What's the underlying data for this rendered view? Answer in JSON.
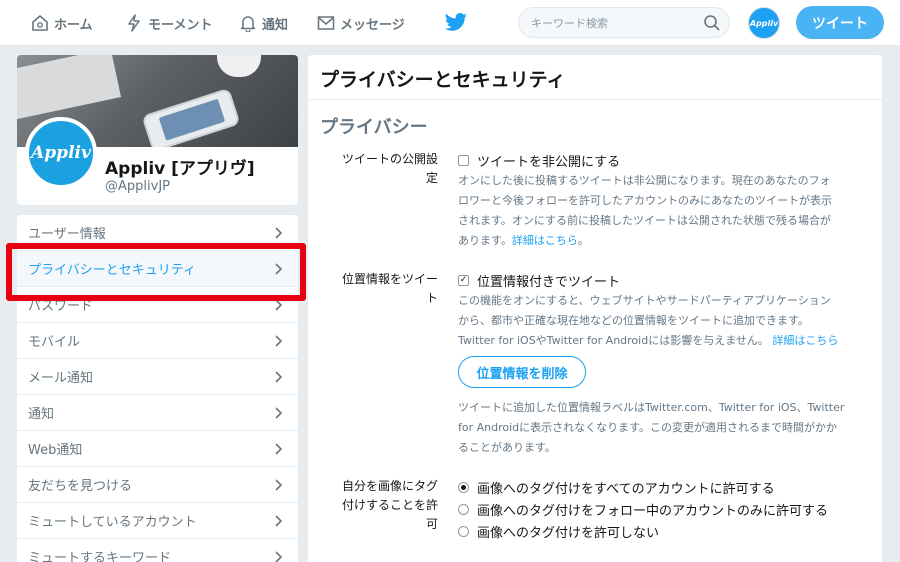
{
  "nav": {
    "home": "ホーム",
    "moments": "モーメント",
    "notifications": "通知",
    "messages": "メッセージ",
    "search_placeholder": "キーワード検索",
    "avatar_text": "Appliv",
    "tweet_button": "ツイート"
  },
  "profile": {
    "avatar_text": "Appliv",
    "name": "Appliv [アプリヴ]",
    "handle": "@ApplivJP"
  },
  "menu": {
    "items": [
      {
        "label": "ユーザー情報"
      },
      {
        "label": "プライバシーとセキュリティ"
      },
      {
        "label": "パスワード"
      },
      {
        "label": "モバイル"
      },
      {
        "label": "メール通知"
      },
      {
        "label": "通知"
      },
      {
        "label": "Web通知"
      },
      {
        "label": "友だちを見つける"
      },
      {
        "label": "ミュートしているアカウント"
      },
      {
        "label": "ミュートするキーワード"
      }
    ]
  },
  "panel": {
    "title": "プライバシーとセキュリティ",
    "section_title": "プライバシー",
    "protect": {
      "label_line1": "ツイートの公開設",
      "label_line2": "定",
      "option": "ツイートを非公開にする",
      "checked": false,
      "desc_lines": [
        "オンにした後に投稿するツイートは非公開になります。現在のあなたのフォ",
        "ロワーと今後フォローを許可したアカウントのみにあなたのツイートが表示",
        "されます。オンにする前に投稿したツイートは公開された状態で残る場合が",
        "あります。"
      ],
      "desc_link": "詳細はこちら",
      "desc_end": "。"
    },
    "location": {
      "label_line1": "位置情報をツイー",
      "label_line2": "ト",
      "option": "位置情報付きでツイート",
      "checked": true,
      "checkmark": "✓",
      "desc_lines": [
        "この機能をオンにすると、ウェブサイトやサードパーティアプリケーション",
        "から、都市や正確な現在地などの位置情報をツイートに追加できます。",
        "Twitter for iOSやTwitter for Androidには影響を与えません。"
      ],
      "desc_link": "詳細はこちら",
      "delete_button": "位置情報を削除",
      "note_lines": [
        "ツイートに追加した位置情報ラベルはTwitter.com、Twitter for iOS、Twitter",
        "for Androidに表示されなくなります。この変更が適用されるまで時間がかか",
        "ることがあります。"
      ]
    },
    "tagging": {
      "label_line1": "自分を画像にタグ",
      "label_line2": "付けすることを許",
      "label_line3": "可",
      "options": [
        {
          "label": "画像へのタグ付けをすべてのアカウントに許可する",
          "selected": true
        },
        {
          "label": "画像へのタグ付けをフォロー中のアカウントのみに許可する",
          "selected": false
        },
        {
          "label": "画像へのタグ付けを許可しない",
          "selected": false
        }
      ]
    }
  },
  "colors": {
    "accent": "#1da1f2",
    "highlight": "#e60012",
    "background": "#e6ecf0"
  }
}
